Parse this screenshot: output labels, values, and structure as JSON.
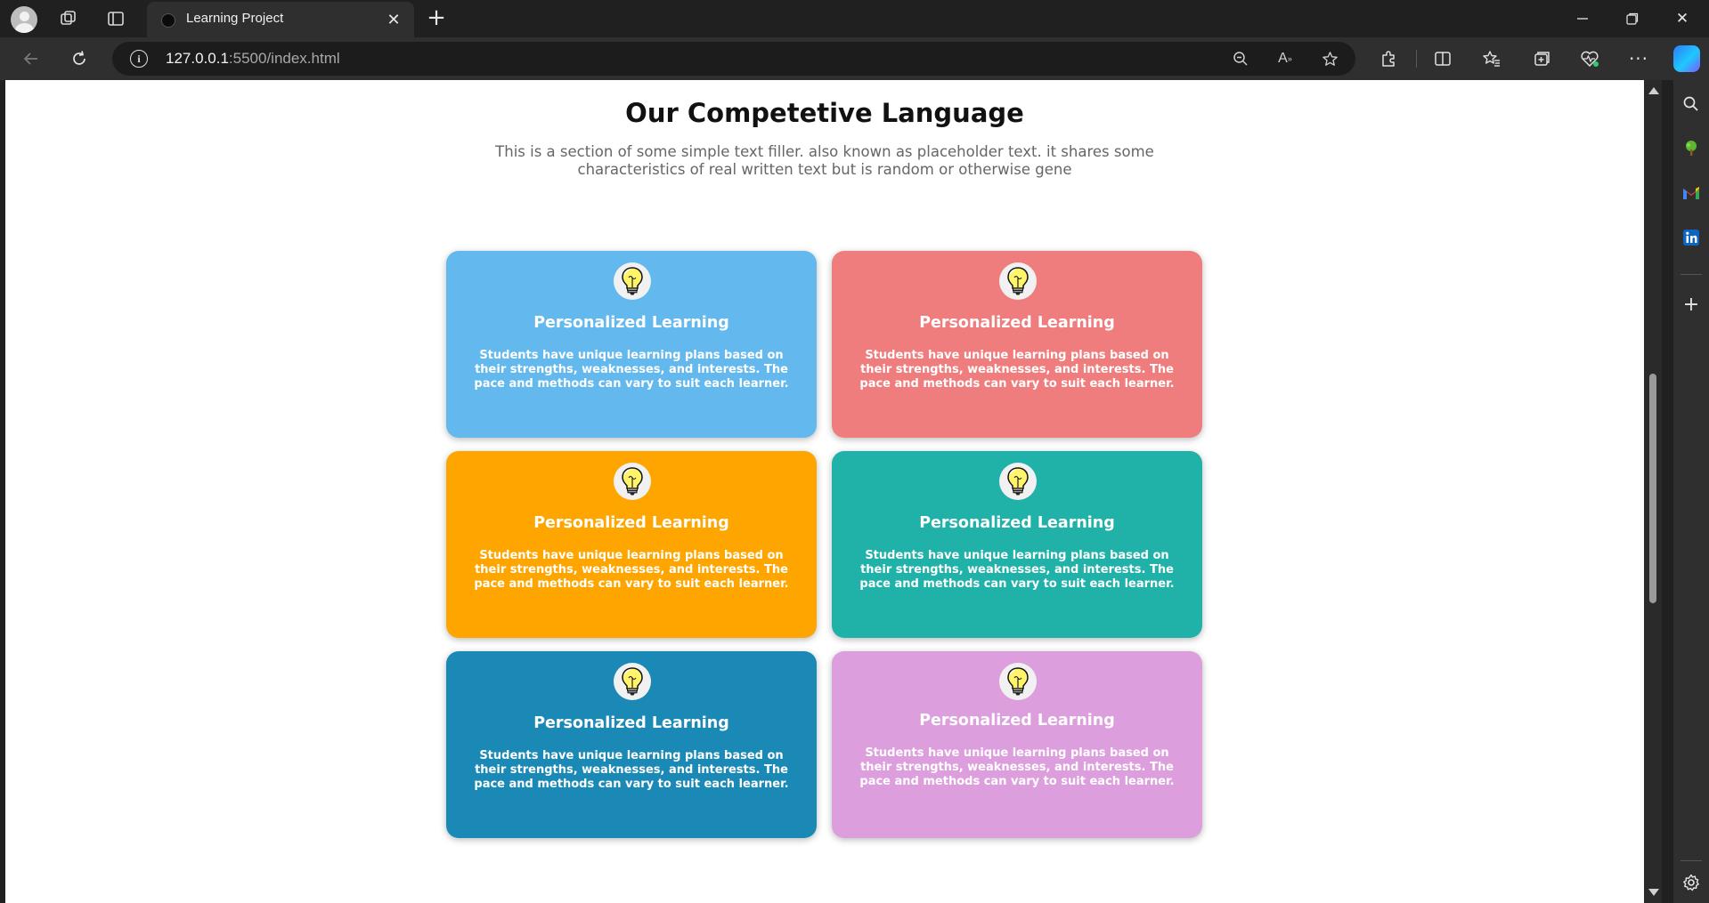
{
  "browser": {
    "tab": {
      "title": "Learning Project"
    },
    "address": {
      "host": "127.0.0.1",
      "path": ":5500/index.html"
    }
  },
  "page": {
    "heading": "Our Competetive Language",
    "subtitle": "This is a section of some simple text filler. also known as placeholder text. it shares some characteristics of real written text but is random or otherwise gene",
    "cards": [
      {
        "title": "Personalized Learning",
        "text": "Students have unique learning plans based on their strengths, weaknesses, and interests. The pace and methods can vary to suit each learner.",
        "color": "#63b8ee",
        "icon": "lightbulb-icon"
      },
      {
        "title": "Personalized Learning",
        "text": "Students have unique learning plans based on their strengths, weaknesses, and interests. The pace and methods can vary to suit each learner.",
        "color": "#f07d7d",
        "icon": "lightbulb-icon"
      },
      {
        "title": "Personalized Learning",
        "text": "Students have unique learning plans based on their strengths, weaknesses, and interests. The pace and methods can vary to suit each learner.",
        "color": "#ffa500",
        "icon": "lightbulb-icon"
      },
      {
        "title": "Personalized Learning",
        "text": "Students have unique learning plans based on their strengths, weaknesses, and interests. The pace and methods can vary to suit each learner.",
        "color": "#20b1a9",
        "icon": "lightbulb-icon"
      },
      {
        "title": "Personalized Learning",
        "text": "Students have unique learning plans based on their strengths, weaknesses, and interests. The pace and methods can vary to suit each learner.",
        "color": "#1a89b6",
        "icon": "lightbulb-icon"
      },
      {
        "title": "Personalized Learning",
        "text": "Students have unique learning plans based on their strengths, weaknesses, and interests. The pace and methods can vary to suit each learner.",
        "color": "#dd9edd",
        "icon": "lightbulb-icon"
      }
    ]
  }
}
